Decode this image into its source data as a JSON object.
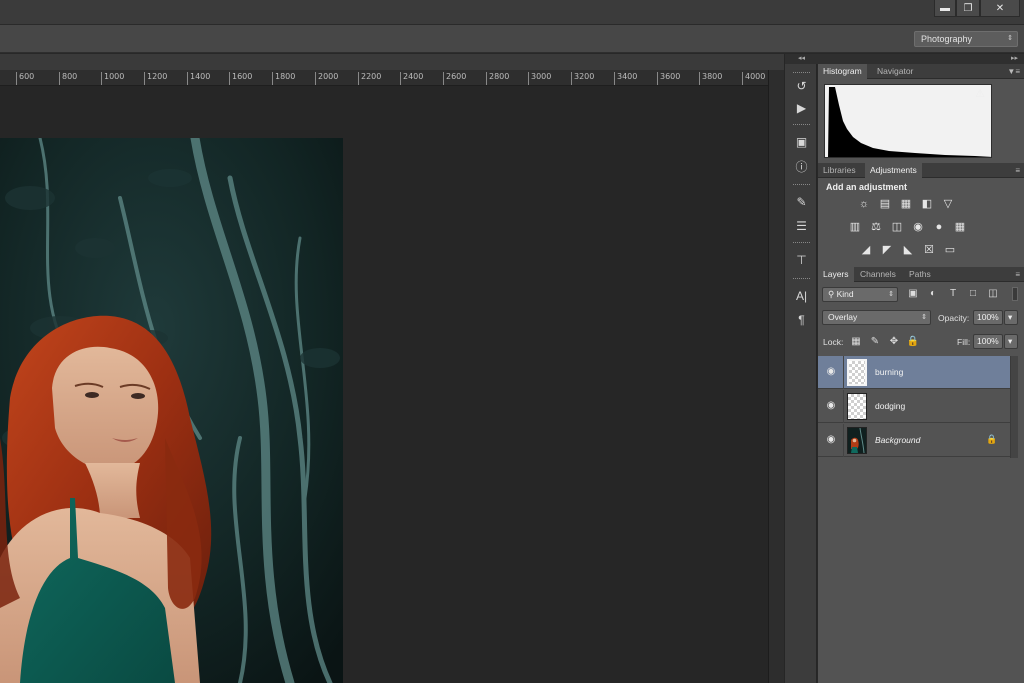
{
  "window": {
    "minimize_icon": "minimize-icon",
    "restore_icon": "restore-icon",
    "close_icon": "close-icon"
  },
  "options_bar": {
    "workspace": "Photography"
  },
  "ruler": {
    "ticks": [
      "600",
      "800",
      "1000",
      "1200",
      "1400",
      "1600",
      "1800",
      "2000",
      "2200",
      "2400",
      "2600",
      "2800",
      "3000",
      "3200",
      "3400",
      "3600",
      "3800",
      "4000"
    ]
  },
  "panels": {
    "top_tabs": [
      "Histogram",
      "Navigator"
    ],
    "mid_tabs": [
      "Libraries",
      "Adjustments"
    ],
    "adjustments_title": "Add an adjustment",
    "layer_tabs": [
      "Layers",
      "Channels",
      "Paths"
    ],
    "filter_kind": "Kind",
    "blend_mode": "Overlay",
    "opacity_label": "Opacity:",
    "opacity_value": "100%",
    "lock_label": "Lock:",
    "fill_label": "Fill:",
    "fill_value": "100%"
  },
  "layers": [
    {
      "name": "burning",
      "selected": true,
      "locked": false,
      "italic": false
    },
    {
      "name": "dodging",
      "selected": false,
      "locked": false,
      "italic": false
    },
    {
      "name": "Background",
      "selected": false,
      "locked": true,
      "italic": true
    }
  ]
}
